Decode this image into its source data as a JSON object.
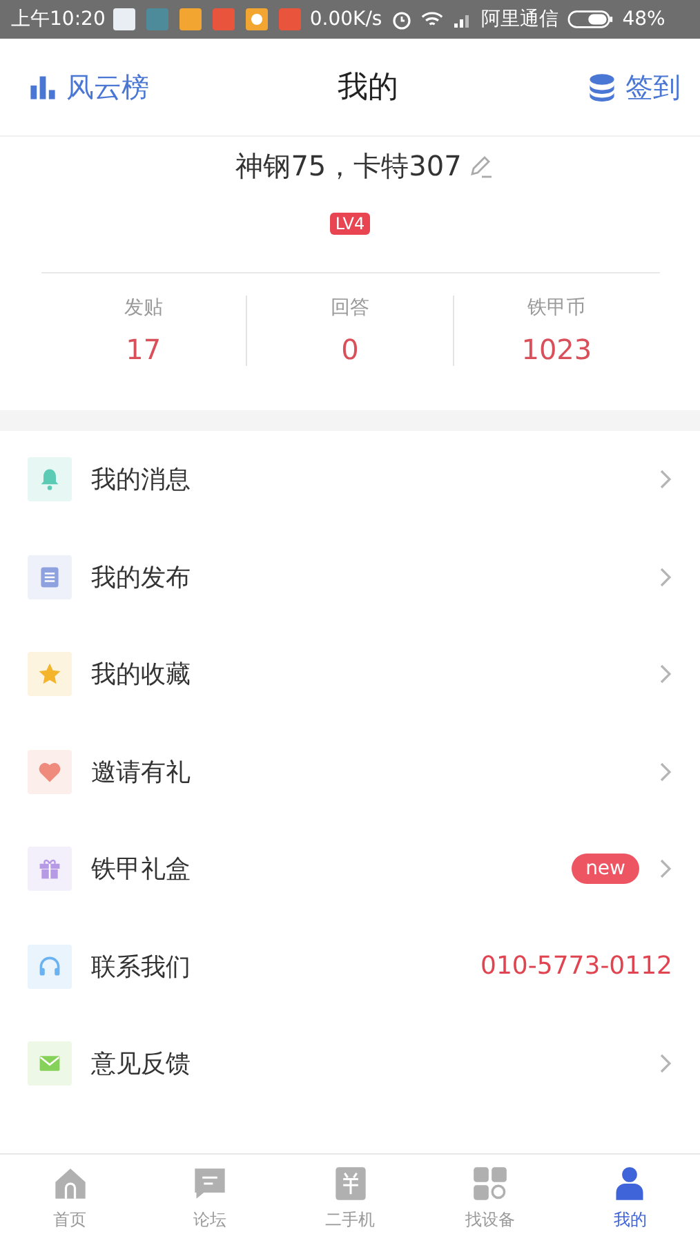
{
  "status_bar": {
    "time": "上午10:20",
    "speed": "0.00K/s",
    "carrier": "阿里通信",
    "battery": "48%"
  },
  "header": {
    "left": "风云榜",
    "title": "我的",
    "right": "签到"
  },
  "profile": {
    "name": "神钢75，卡特307",
    "level": "LV4"
  },
  "stats": [
    {
      "label": "发贴",
      "value": "17"
    },
    {
      "label": "回答",
      "value": "0"
    },
    {
      "label": "铁甲币",
      "value": "1023"
    }
  ],
  "menu": [
    {
      "kind": "link",
      "color": "#5ccbb5",
      "label": "我的消息"
    },
    {
      "kind": "link",
      "color": "#8fa2e0",
      "label": "我的发布"
    },
    {
      "kind": "link",
      "color": "#f4b52c",
      "label": "我的收藏"
    },
    {
      "kind": "link",
      "color": "#ee8b7c",
      "label": "邀请有礼"
    },
    {
      "kind": "badge",
      "color": "#b79ae6",
      "label": "铁甲礼盒",
      "badge": "new"
    },
    {
      "kind": "phone",
      "color": "#6ab3f0",
      "label": "联系我们",
      "value": "010-5773-0112"
    },
    {
      "kind": "link",
      "color": "#86d15a",
      "label": "意见反馈"
    }
  ],
  "tabs": [
    {
      "label": "首页",
      "selected": false
    },
    {
      "label": "论坛",
      "selected": false
    },
    {
      "label": "二手机",
      "selected": false
    },
    {
      "label": "找设备",
      "selected": false
    },
    {
      "label": "我的",
      "selected": true
    }
  ]
}
